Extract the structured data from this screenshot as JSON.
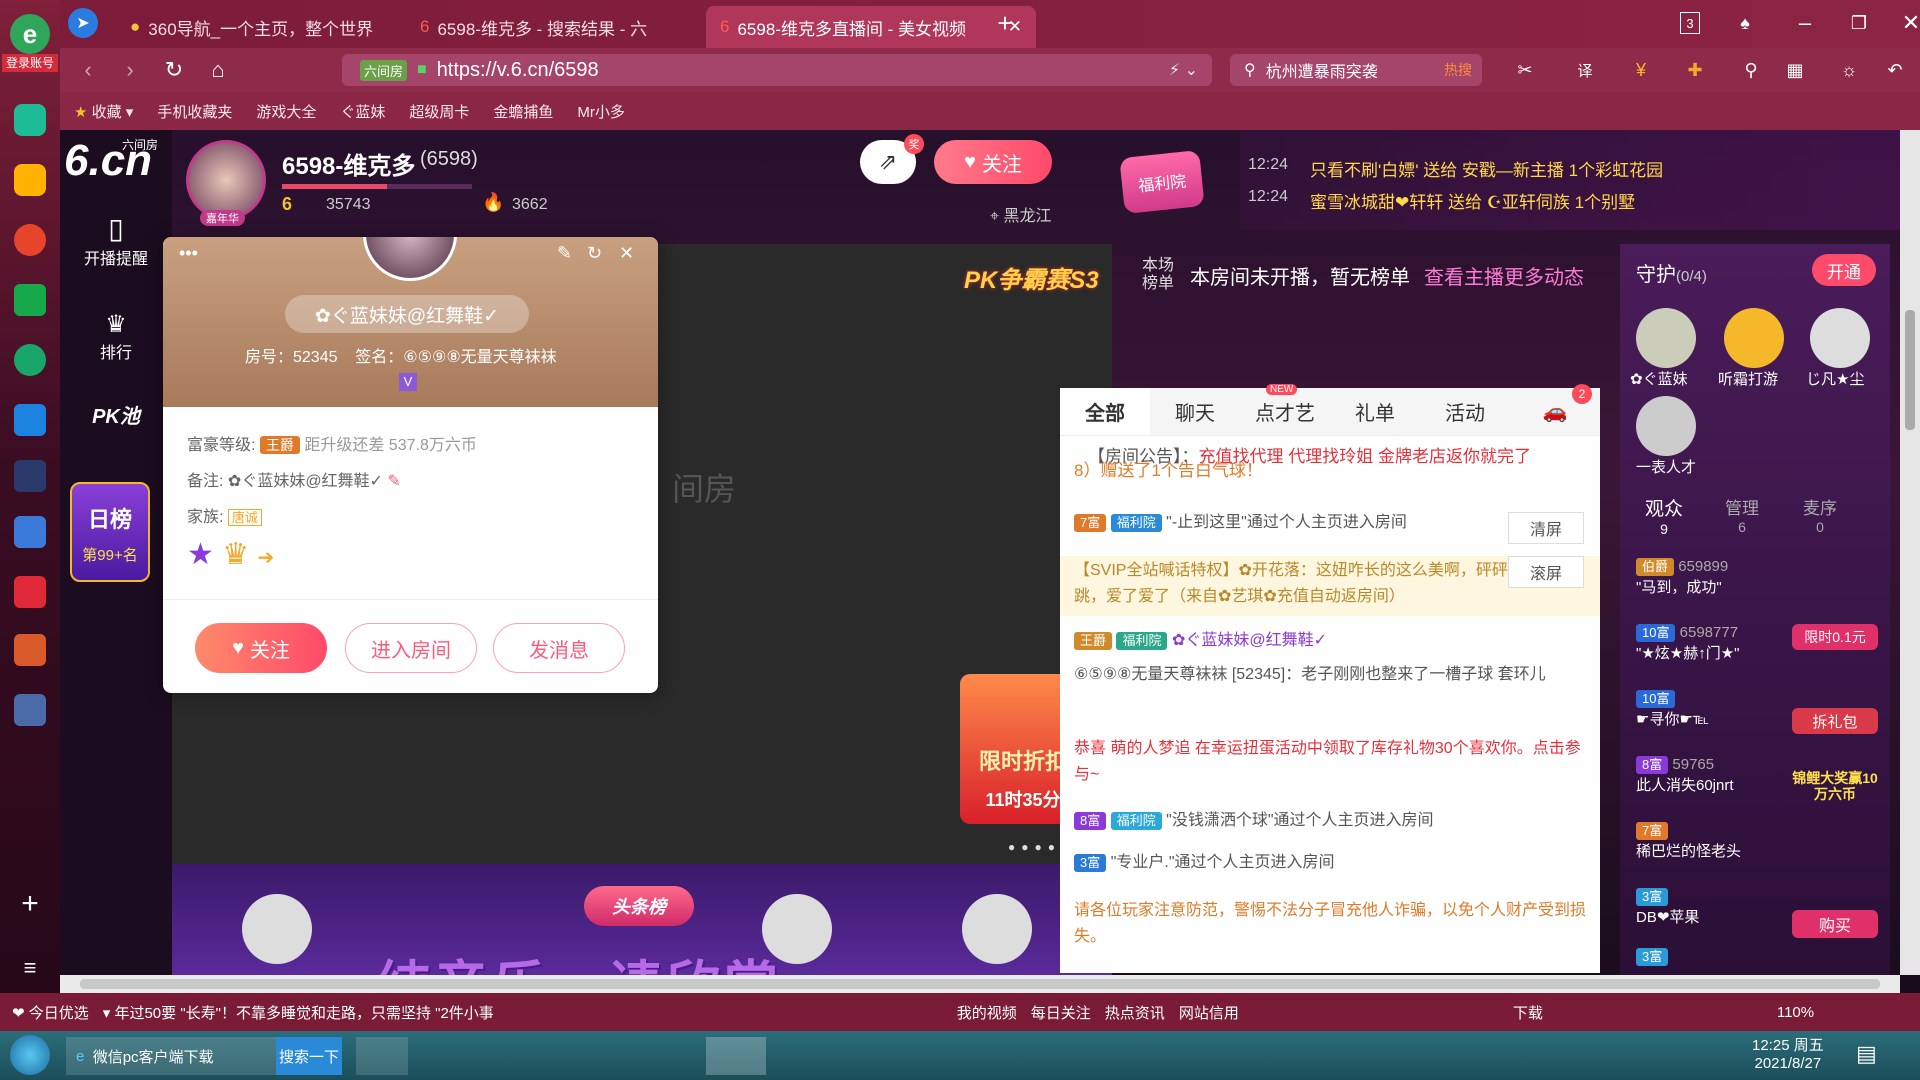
{
  "browser": {
    "login_label": "登录账号",
    "tabs": [
      {
        "label": "360导航_一个主页，整个世界"
      },
      {
        "label": "6598-维克多 - 搜索结果 - 六"
      },
      {
        "label": "6598-维克多直播间 - 美女视频"
      }
    ],
    "tab_count": "3",
    "url_prefix": "六间房",
    "url": "https://v.6.cn/6598",
    "search_text": "杭州遭暴雨突袭",
    "search_hot": "热搜",
    "bookmarks": [
      "收藏",
      "手机收藏夹",
      "游戏大全",
      "ぐ蓝妹",
      "超级周卡",
      "金蟾捕鱼",
      "Mr小多"
    ]
  },
  "site": {
    "logo_text": "6.cn",
    "logo_sub": "六间房",
    "nav": [
      {
        "label": "开播提醒"
      },
      {
        "label": "排行"
      },
      {
        "label": "PK池"
      }
    ],
    "daily_rank_title": "日榜",
    "daily_rank_value": "第99+名"
  },
  "anchor": {
    "name": "6598-维克多",
    "room_id": "(6598)",
    "level_num": "6",
    "fans": "35743",
    "heat": "3662",
    "location": "黑龙江",
    "follow_label": "关注",
    "share_badge": "奖",
    "avatar_badge": "嘉年华"
  },
  "broadcast": {
    "items": [
      {
        "time": "12:24",
        "text": "只看不刷'白嫖' 送给 安戳—新主播 1个彩虹花园"
      },
      {
        "time": "12:24",
        "text": "蜜雪冰城甜❤轩轩 送给 ☪亚轩伺族 1个别墅"
      }
    ],
    "fuli_label": "福利院"
  },
  "stage": {
    "pk_banner": "PK争霸赛S3",
    "watermark": "间房",
    "promo_title": "限时折扣",
    "promo_time": "11时35分",
    "overlay_caption": "纯音乐，请欣赏",
    "headline_label": "头条榜"
  },
  "ranking_bar": {
    "label": "本场榜单",
    "text": "本房间未开播，暂无榜单",
    "link": "查看主播更多动态"
  },
  "chat": {
    "tabs": [
      "全部",
      "聊天",
      "点才艺",
      "礼单",
      "活动"
    ],
    "new_badge": "NEW",
    "car_count": "2",
    "announcement_label": "【房间公告】：",
    "announcement": "充值找代理 代理找玲姐 金牌老店返你就完了",
    "gift_line": "8）赠送了1个告白气球！",
    "clear_label": "清屏",
    "scroll_label": "滚屏",
    "messages": [
      {
        "level": "7富",
        "tag": "福利院",
        "text": "\"-止到这里\"通过个人主页进入房间"
      },
      {
        "level": "",
        "tag": "",
        "text": "【SVIP全站喊话特权】✿开花落：这妞咋长的这么美啊，砰砰跳，爱了爱了（来自✿艺琪✿充值自动返房间）"
      },
      {
        "level": "王爵",
        "tag": "福利院",
        "text": "✿ぐ蓝妹妹@红舞鞋✓"
      },
      {
        "level": "",
        "tag": "",
        "text": "⑥⑤⑨⑧无量天尊袜袜 [52345]：老子刚刚也整来了一槽子球 套环儿"
      },
      {
        "level": "",
        "tag": "",
        "text": "恭喜 萌的人梦追 在幸运扭蛋活动中领取了库存礼物30个喜欢你。点击参与~"
      },
      {
        "level": "8富",
        "tag": "福利院",
        "text": "\"没钱潇洒个球\"通过个人主页进入房间"
      },
      {
        "level": "3富",
        "tag": "",
        "text": "\"专业户.\"通过个人主页进入房间"
      }
    ],
    "warning": "请各位玩家注意防范，警惕不法分子冒充他人诈骗，以免个人财产受到损失。"
  },
  "guard": {
    "title": "守护",
    "count": "(0/4)",
    "open_label": "开通",
    "guardians": [
      "✿ぐ蓝妹",
      "听霜打游",
      "じ凡★尘",
      "一表人才"
    ],
    "tabs": [
      {
        "label": "观众",
        "count": "9"
      },
      {
        "label": "管理",
        "count": "6"
      },
      {
        "label": "麦序",
        "count": "0"
      }
    ],
    "viewers": [
      {
        "level": "伯爵",
        "name": "\"马到，成功\"",
        "num": "659899"
      },
      {
        "level": "10富",
        "name": "\"★炫★赫↑门★\"",
        "num": "6598777"
      },
      {
        "level": "10富",
        "name": "☛寻你☛℡",
        "num": ""
      },
      {
        "level": "8富",
        "name": "此人消失60jnrt",
        "num": "59765"
      },
      {
        "level": "7富",
        "name": "稀巴烂的怪老头",
        "num": ""
      },
      {
        "level": "3富",
        "name": "DB❤苹果",
        "num": ""
      },
      {
        "level": "3富",
        "name": "",
        "num": ""
      }
    ],
    "promos": [
      "限时0.1元",
      "拆礼包",
      "锦鲤大奖赢10万六币",
      "购买"
    ]
  },
  "popup": {
    "username": "✿ぐ蓝妹妹@红舞鞋✓",
    "room_label": "房号：52345",
    "sign_label": "签名：⑥⑤⑨⑧无量天尊袜袜",
    "v_badge": "V",
    "wealth_label": "富豪等级:",
    "wealth_level": "王爵",
    "upgrade_text": "距升级还差 537.8万六币",
    "note_label": "备注:",
    "note_value": "✿ぐ蓝妹妹@红舞鞋✓",
    "family_label": "家族:",
    "family_value": "唐诚",
    "follow": "关注",
    "enter_room": "进入房间",
    "send_msg": "发消息"
  },
  "statusbar": {
    "left_items": [
      "今日优选",
      "年过50要 \"长寿\"！不靠多睡觉和走路，只需坚持 \"2件小事"
    ],
    "right_items": [
      "我的视频",
      "每日关注",
      "热点资讯",
      "网站信用",
      "下载"
    ],
    "zoom": "110%"
  },
  "taskbar": {
    "items": [
      "微信pc客户端下载",
      "搜索一下"
    ],
    "time": "12:25 周五",
    "date": "2021/8/27"
  }
}
